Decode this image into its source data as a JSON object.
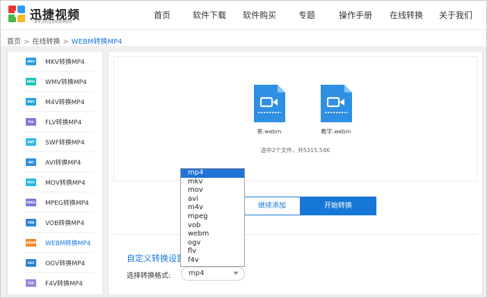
{
  "brand": {
    "name": "迅捷视频",
    "tagline": "一家专业的音视频转换服务"
  },
  "nav": [
    {
      "label": "首页"
    },
    {
      "label": "软件下载"
    },
    {
      "label": "软件购买"
    },
    {
      "label": "专题"
    },
    {
      "label": "操作手册"
    },
    {
      "label": "在线转换"
    },
    {
      "label": "关于我们"
    }
  ],
  "breadcrumb": {
    "home": "首页",
    "section": "在线转换",
    "current": "WEBM转换MP4",
    "sep": ">"
  },
  "sidebar": {
    "items": [
      {
        "badge": "MKV",
        "label": "MKV转换MP4",
        "color": "#2b9ae8"
      },
      {
        "badge": "WMV",
        "label": "WMV转换MP4",
        "color": "#1fc6b5"
      },
      {
        "badge": "M4V",
        "label": "M4V转换MP4",
        "color": "#28a4e0"
      },
      {
        "badge": "FLV",
        "label": "FLV转换MP4",
        "color": "#8b72d6"
      },
      {
        "badge": "SWF",
        "label": "SWF转换MP4",
        "color": "#36b8e8"
      },
      {
        "badge": "AVI",
        "label": "AVI转换MP4",
        "color": "#2f8fe0"
      },
      {
        "badge": "MOV",
        "label": "MOV转换MP4",
        "color": "#25b7e6"
      },
      {
        "badge": "MPEG",
        "label": "MPEG转换MP4",
        "color": "#7a76de"
      },
      {
        "badge": "VOB",
        "label": "VOB转换MP4",
        "color": "#2e84d8"
      },
      {
        "badge": "WEBM",
        "label": "WEBM转换MP4",
        "color": "#f08a24",
        "active": true
      },
      {
        "badge": "OGV",
        "label": "OGV转换MP4",
        "color": "#2a7fd0"
      },
      {
        "badge": "F4V",
        "label": "F4V转换MP4",
        "color": "#9a86e0"
      }
    ]
  },
  "files": [
    {
      "name": "茶.webm",
      "icon": "video-file-icon"
    },
    {
      "name": "教学.webm",
      "icon": "video-file-icon"
    }
  ],
  "file_summary": "选中2个文件，共5315.54K",
  "buttons": {
    "continue": "继续添加",
    "start": "开始转换"
  },
  "settings": {
    "title": "自定义转换设置",
    "format_label": "选择转换格式:",
    "format_value": "mp4"
  },
  "dropdown": {
    "options": [
      "mp4",
      "mkv",
      "mov",
      "avi",
      "m4v",
      "mpeg",
      "vob",
      "webm",
      "ogv",
      "flv",
      "f4v"
    ],
    "selected": "mp4"
  },
  "colors": {
    "accent": "#1677d8",
    "file_icon": "#2e8fe3",
    "selected_option": "#1e74d6"
  }
}
